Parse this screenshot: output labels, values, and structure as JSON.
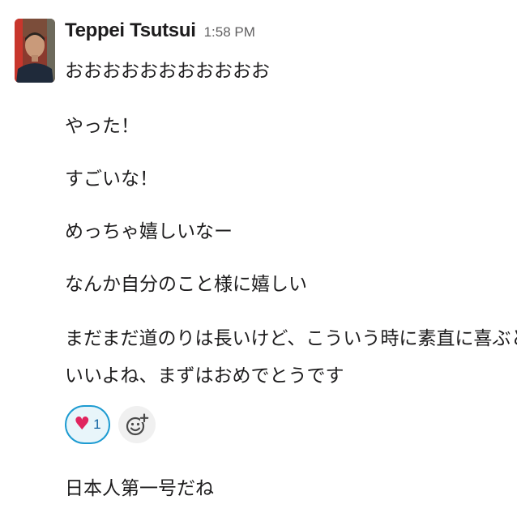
{
  "message": {
    "author": "Teppei Tsutsui",
    "timestamp": "1:58 PM",
    "lines": [
      "おおおおおおおおおおお",
      "やった！",
      "すごいな！",
      "めっちゃ嬉しいなー",
      "なんか自分のこと様に嬉しい",
      "まだまだ道のりは長いけど、こういう時に素直に喜ぶと",
      "いいよね、まずはおめでとうです"
    ],
    "reactions": [
      {
        "emoji": "heart-emoji",
        "count": "1"
      }
    ],
    "add_reaction_icon": "add-emoji-icon",
    "followup_line": "日本人第一号だね"
  },
  "colors": {
    "text": "#1d1c1d",
    "timestamp": "#616061",
    "reaction_border": "#1d9bd1",
    "reaction_bg": "#e8f5fa",
    "reaction_count": "#1264a3",
    "heart": "#e0245e"
  }
}
